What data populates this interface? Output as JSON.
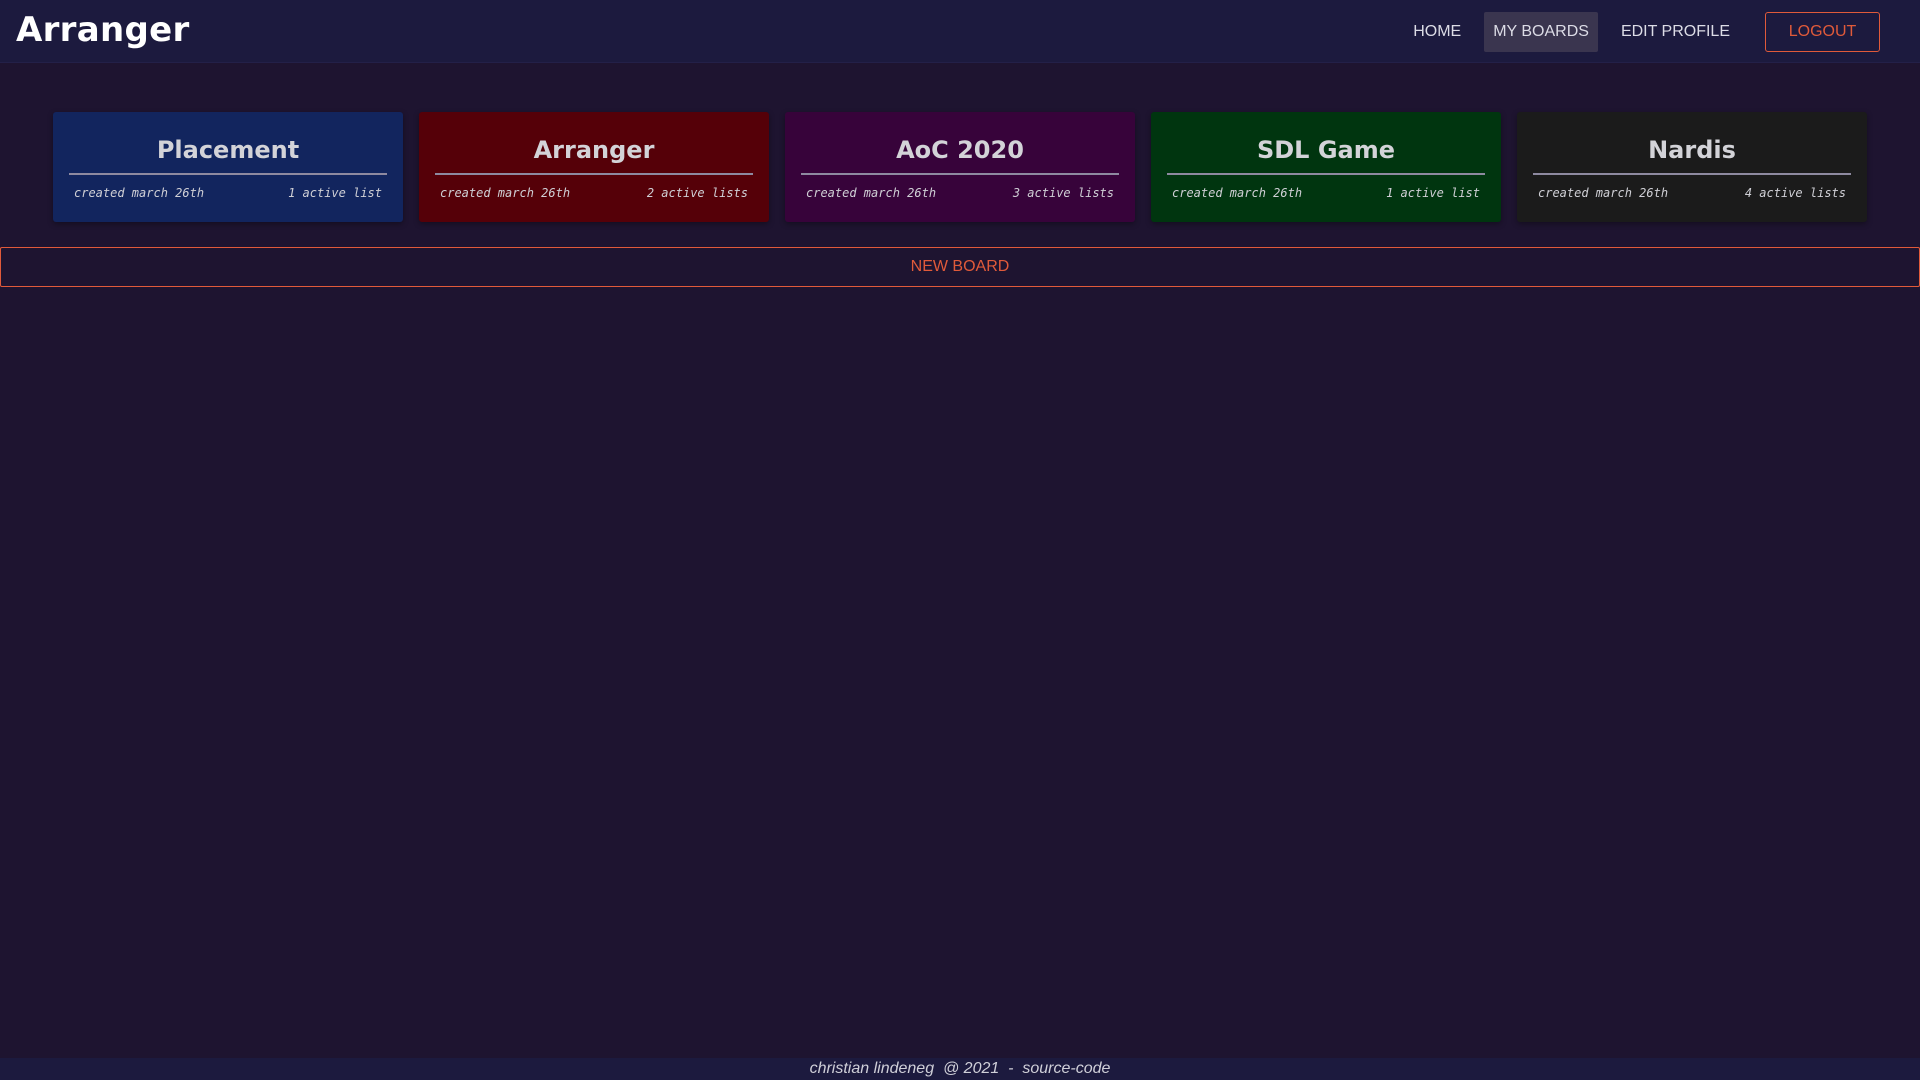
{
  "app": {
    "title": "Arranger"
  },
  "nav": {
    "home": "HOME",
    "my_boards": "MY BOARDS",
    "edit_profile": "EDIT PROFILE",
    "logout": "LOGOUT"
  },
  "boards": [
    {
      "title": "Placement",
      "created": "created march 26th",
      "lists": "1 active list",
      "color": "#12255e"
    },
    {
      "title": "Arranger",
      "created": "created march 26th",
      "lists": "2 active lists",
      "color": "#550008"
    },
    {
      "title": "AoC 2020",
      "created": "created march 26th",
      "lists": "3 active lists",
      "color": "#37033a"
    },
    {
      "title": "SDL Game",
      "created": "created march 26th",
      "lists": "1 active list",
      "color": "#00350f"
    },
    {
      "title": "Nardis",
      "created": "created march 26th",
      "lists": "4 active lists",
      "color": "#1b1b1b"
    }
  ],
  "new_board": {
    "label": "NEW BOARD"
  },
  "footer": {
    "author": "christian lindeneg",
    "year": "@ 2021",
    "sep": "-",
    "source": "source-code"
  },
  "colors": {
    "accent": "#e05a3a",
    "navbar": "#1c1a3e",
    "background": "#1e1430"
  }
}
